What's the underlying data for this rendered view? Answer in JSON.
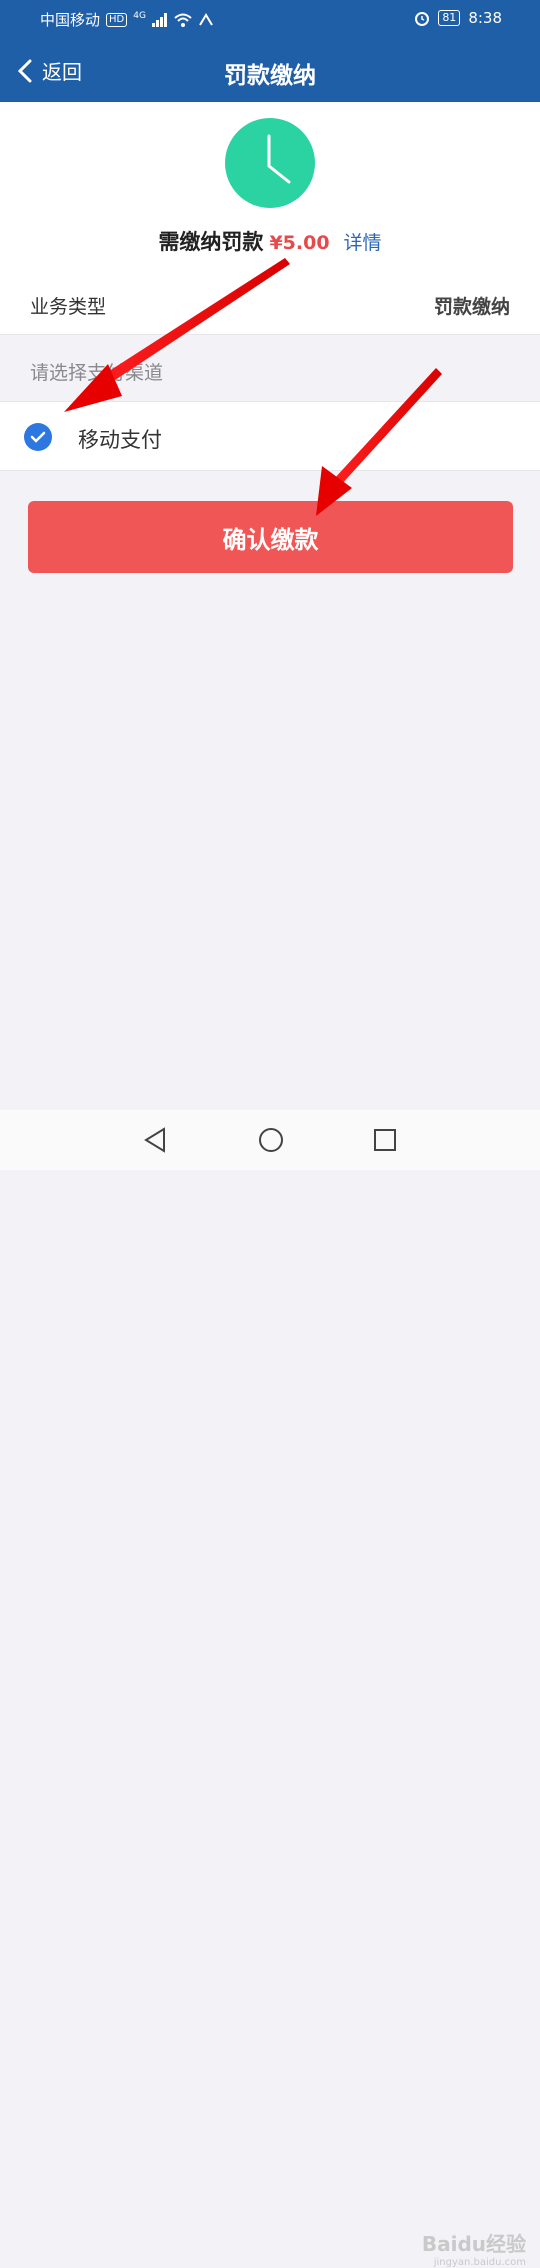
{
  "status_bar": {
    "carrier": "中国移动",
    "hd": "HD",
    "network": "4G",
    "battery": "81",
    "time": "8:38"
  },
  "nav": {
    "back_label": "返回",
    "title": "罚款缴纳"
  },
  "fine": {
    "label": "需缴纳罚款",
    "amount": "¥5.00",
    "detail_link": "详情"
  },
  "business": {
    "label": "业务类型",
    "value": "罚款缴纳"
  },
  "payment": {
    "section_hint": "请选择支付渠道",
    "option_label": "移动支付",
    "selected": true
  },
  "confirm_button": "确认缴款",
  "watermark": {
    "text": "Baidu经验",
    "sub": "jingyan.baidu.com"
  },
  "colors": {
    "header": "#1f5fa8",
    "accent_red": "#f05656",
    "clock_green": "#2bd3a3",
    "check_blue": "#2c77e0"
  }
}
